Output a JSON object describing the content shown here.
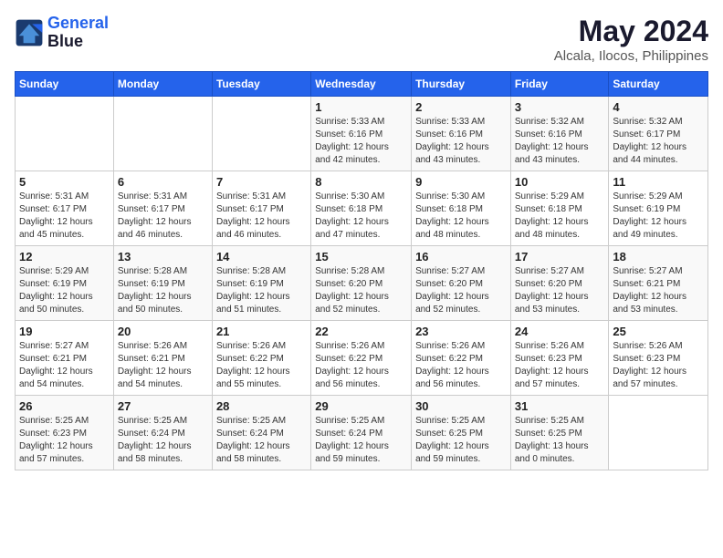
{
  "header": {
    "logo_line1": "General",
    "logo_line2": "Blue",
    "month": "May 2024",
    "location": "Alcala, Ilocos, Philippines"
  },
  "days_of_week": [
    "Sunday",
    "Monday",
    "Tuesday",
    "Wednesday",
    "Thursday",
    "Friday",
    "Saturday"
  ],
  "weeks": [
    [
      {
        "day": "",
        "info": ""
      },
      {
        "day": "",
        "info": ""
      },
      {
        "day": "",
        "info": ""
      },
      {
        "day": "1",
        "info": "Sunrise: 5:33 AM\nSunset: 6:16 PM\nDaylight: 12 hours\nand 42 minutes."
      },
      {
        "day": "2",
        "info": "Sunrise: 5:33 AM\nSunset: 6:16 PM\nDaylight: 12 hours\nand 43 minutes."
      },
      {
        "day": "3",
        "info": "Sunrise: 5:32 AM\nSunset: 6:16 PM\nDaylight: 12 hours\nand 43 minutes."
      },
      {
        "day": "4",
        "info": "Sunrise: 5:32 AM\nSunset: 6:17 PM\nDaylight: 12 hours\nand 44 minutes."
      }
    ],
    [
      {
        "day": "5",
        "info": "Sunrise: 5:31 AM\nSunset: 6:17 PM\nDaylight: 12 hours\nand 45 minutes."
      },
      {
        "day": "6",
        "info": "Sunrise: 5:31 AM\nSunset: 6:17 PM\nDaylight: 12 hours\nand 46 minutes."
      },
      {
        "day": "7",
        "info": "Sunrise: 5:31 AM\nSunset: 6:17 PM\nDaylight: 12 hours\nand 46 minutes."
      },
      {
        "day": "8",
        "info": "Sunrise: 5:30 AM\nSunset: 6:18 PM\nDaylight: 12 hours\nand 47 minutes."
      },
      {
        "day": "9",
        "info": "Sunrise: 5:30 AM\nSunset: 6:18 PM\nDaylight: 12 hours\nand 48 minutes."
      },
      {
        "day": "10",
        "info": "Sunrise: 5:29 AM\nSunset: 6:18 PM\nDaylight: 12 hours\nand 48 minutes."
      },
      {
        "day": "11",
        "info": "Sunrise: 5:29 AM\nSunset: 6:19 PM\nDaylight: 12 hours\nand 49 minutes."
      }
    ],
    [
      {
        "day": "12",
        "info": "Sunrise: 5:29 AM\nSunset: 6:19 PM\nDaylight: 12 hours\nand 50 minutes."
      },
      {
        "day": "13",
        "info": "Sunrise: 5:28 AM\nSunset: 6:19 PM\nDaylight: 12 hours\nand 50 minutes."
      },
      {
        "day": "14",
        "info": "Sunrise: 5:28 AM\nSunset: 6:19 PM\nDaylight: 12 hours\nand 51 minutes."
      },
      {
        "day": "15",
        "info": "Sunrise: 5:28 AM\nSunset: 6:20 PM\nDaylight: 12 hours\nand 52 minutes."
      },
      {
        "day": "16",
        "info": "Sunrise: 5:27 AM\nSunset: 6:20 PM\nDaylight: 12 hours\nand 52 minutes."
      },
      {
        "day": "17",
        "info": "Sunrise: 5:27 AM\nSunset: 6:20 PM\nDaylight: 12 hours\nand 53 minutes."
      },
      {
        "day": "18",
        "info": "Sunrise: 5:27 AM\nSunset: 6:21 PM\nDaylight: 12 hours\nand 53 minutes."
      }
    ],
    [
      {
        "day": "19",
        "info": "Sunrise: 5:27 AM\nSunset: 6:21 PM\nDaylight: 12 hours\nand 54 minutes."
      },
      {
        "day": "20",
        "info": "Sunrise: 5:26 AM\nSunset: 6:21 PM\nDaylight: 12 hours\nand 54 minutes."
      },
      {
        "day": "21",
        "info": "Sunrise: 5:26 AM\nSunset: 6:22 PM\nDaylight: 12 hours\nand 55 minutes."
      },
      {
        "day": "22",
        "info": "Sunrise: 5:26 AM\nSunset: 6:22 PM\nDaylight: 12 hours\nand 56 minutes."
      },
      {
        "day": "23",
        "info": "Sunrise: 5:26 AM\nSunset: 6:22 PM\nDaylight: 12 hours\nand 56 minutes."
      },
      {
        "day": "24",
        "info": "Sunrise: 5:26 AM\nSunset: 6:23 PM\nDaylight: 12 hours\nand 57 minutes."
      },
      {
        "day": "25",
        "info": "Sunrise: 5:26 AM\nSunset: 6:23 PM\nDaylight: 12 hours\nand 57 minutes."
      }
    ],
    [
      {
        "day": "26",
        "info": "Sunrise: 5:25 AM\nSunset: 6:23 PM\nDaylight: 12 hours\nand 57 minutes."
      },
      {
        "day": "27",
        "info": "Sunrise: 5:25 AM\nSunset: 6:24 PM\nDaylight: 12 hours\nand 58 minutes."
      },
      {
        "day": "28",
        "info": "Sunrise: 5:25 AM\nSunset: 6:24 PM\nDaylight: 12 hours\nand 58 minutes."
      },
      {
        "day": "29",
        "info": "Sunrise: 5:25 AM\nSunset: 6:24 PM\nDaylight: 12 hours\nand 59 minutes."
      },
      {
        "day": "30",
        "info": "Sunrise: 5:25 AM\nSunset: 6:25 PM\nDaylight: 12 hours\nand 59 minutes."
      },
      {
        "day": "31",
        "info": "Sunrise: 5:25 AM\nSunset: 6:25 PM\nDaylight: 13 hours\nand 0 minutes."
      },
      {
        "day": "",
        "info": ""
      }
    ]
  ]
}
